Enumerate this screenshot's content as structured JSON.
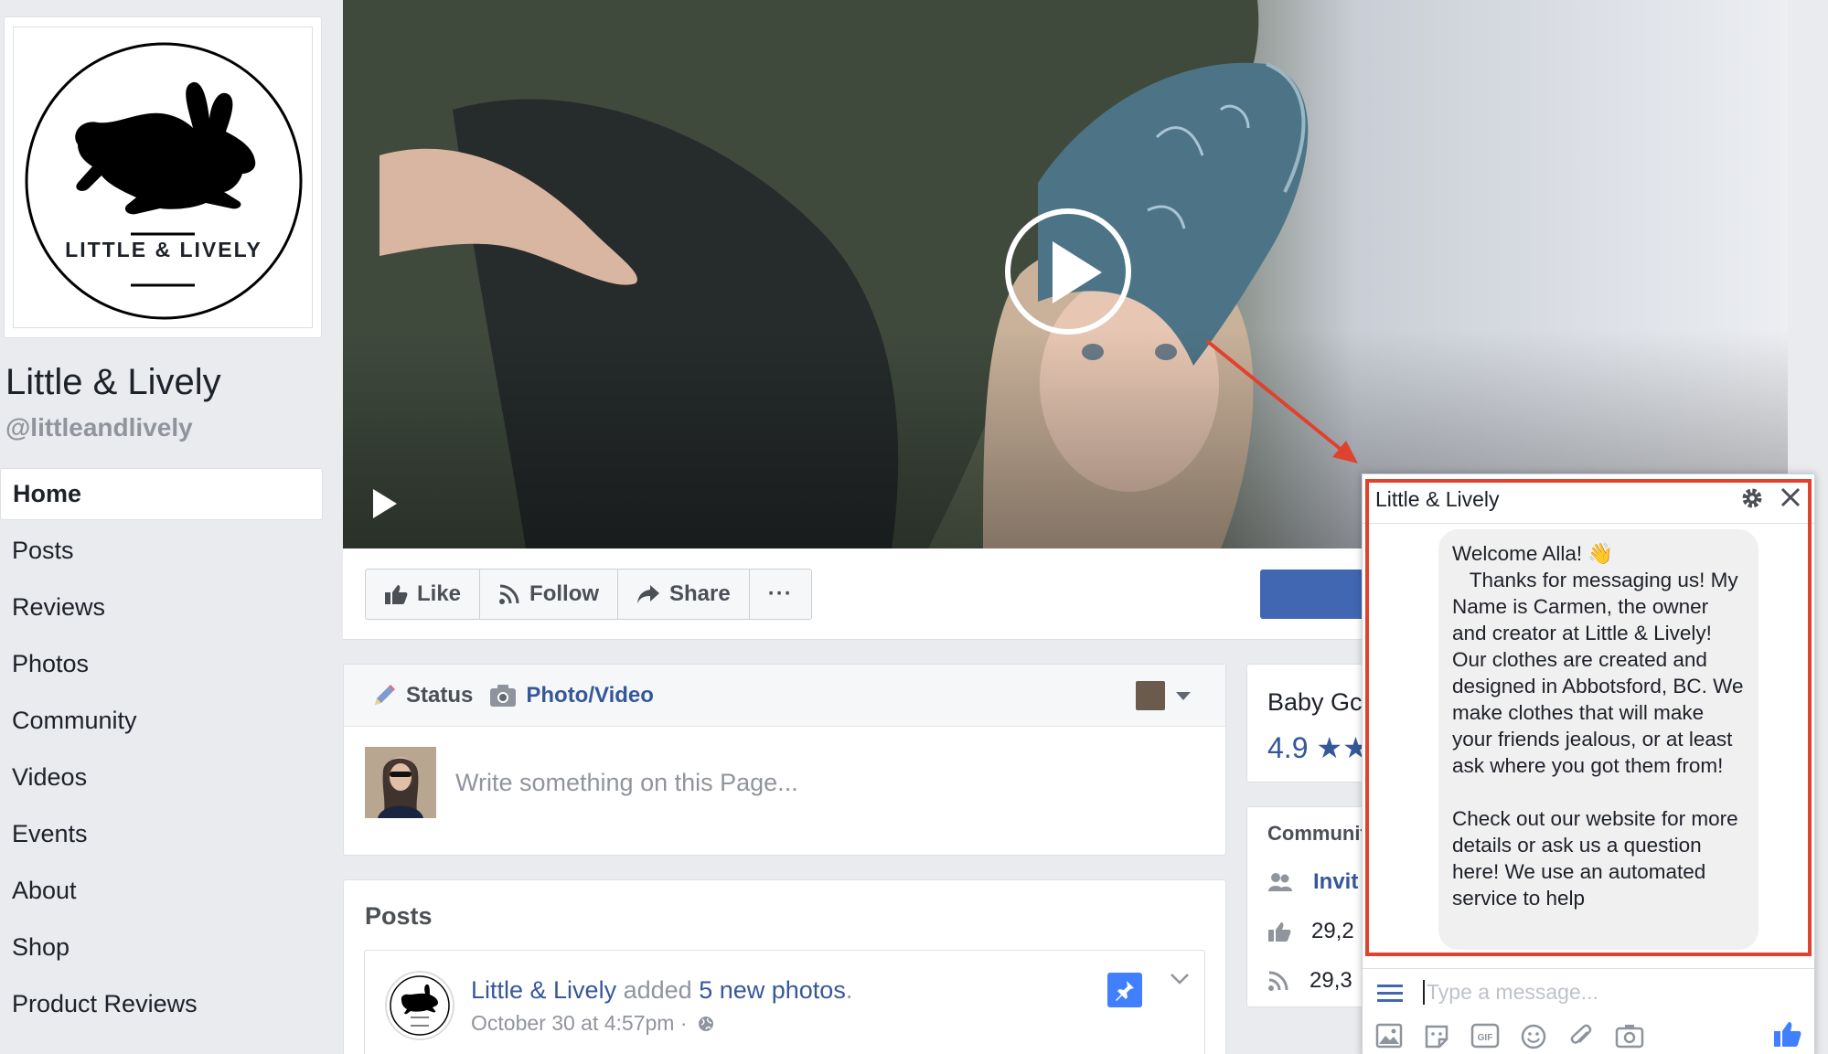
{
  "page": {
    "logo_text": "LITTLE & LIVELY",
    "name": "Little & Lively",
    "handle": "@littleandlively"
  },
  "nav": [
    "Home",
    "Posts",
    "Reviews",
    "Photos",
    "Community",
    "Videos",
    "Events",
    "About",
    "Shop",
    "Product Reviews"
  ],
  "actions": {
    "like": "Like",
    "follow": "Follow",
    "share": "Share",
    "more": "···"
  },
  "composer": {
    "status_tab": "Status",
    "photo_tab": "Photo/Video",
    "placeholder": "Write something on this Page..."
  },
  "posts": {
    "title": "Posts",
    "author": "Little & Lively",
    "action": "added",
    "object": "5 new photos",
    "period": ".",
    "time": "October 30 at 4:57pm ·"
  },
  "rating": {
    "title": "Baby Gc",
    "value": "4.9 ★★"
  },
  "community": {
    "title": "Communit",
    "invite": "Invit",
    "likes": "29,2",
    "follows": "29,3"
  },
  "chat": {
    "title": "Little & Lively",
    "message": "Welcome Alla! 👋\n   Thanks for messaging us! My Name is Carmen, the owner and creator at Little & Lively! Our clothes are created and designed in Abbotsford, BC. We make clothes that will make your friends jealous, or at least ask where you got them from!\n\nCheck out our website for more details or ask us a question here! We use an automated service to help",
    "input_placeholder": "Type a message..."
  },
  "colors": {
    "fb_blue": "#4267b2",
    "link": "#365899",
    "highlight": "#e0422d",
    "background": "#e9ebee"
  }
}
